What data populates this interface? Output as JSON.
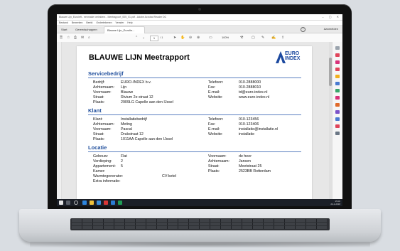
{
  "window": {
    "title": "Blauwe Lijn_Euroleft - eenmalie verleiders - Meetrapport_005_01.pdf - Adobe Acrobat Reader DC",
    "menu": [
      "Bestand",
      "Bewerken",
      "Beeld",
      "Ondertekenen",
      "Venster",
      "Help"
    ],
    "tabs": [
      "Start",
      "Gereedschappen",
      "Blauwe Lijn_Eurolin..."
    ],
    "tab_right": "Aanmelden",
    "help": "?",
    "page_current": "1",
    "page_total": "/ 1",
    "zoom": "100%"
  },
  "document": {
    "title": "BLAUWE LIJN  Meetrapport",
    "logo": {
      "line1": "EURO",
      "line2": "INDEX"
    },
    "sections": {
      "servicebedrijf": {
        "heading": "Servicebedrijf",
        "left": [
          {
            "label": "Bedrijf:",
            "value": "EURO-INDEX b.v."
          },
          {
            "label": "Achternaam:",
            "value": "Lijn"
          },
          {
            "label": "Voornaam:",
            "value": "Blauwe"
          },
          {
            "label": "Straat:",
            "value": "Rivium 2e straat  12"
          },
          {
            "label": "Plaats:",
            "value": "2909LG Capelle aan den IJssel"
          }
        ],
        "right": [
          {
            "label": "Telefoon:",
            "value": "010-2888000"
          },
          {
            "label": "Fax:",
            "value": "010-2888010"
          },
          {
            "label": "E-mail:",
            "value": "td@euro-index.nl"
          },
          {
            "label": "Website:",
            "value": "www.euro-index.nl"
          }
        ]
      },
      "klant": {
        "heading": "Klant",
        "left": [
          {
            "label": "Klant:",
            "value": "Installatiebedrijf"
          },
          {
            "label": "Achternaam:",
            "value": "Meting"
          },
          {
            "label": "Voornaam:",
            "value": "Pascal"
          },
          {
            "label": "Straat:",
            "value": "Drukstraat 12"
          },
          {
            "label": "Plaats:",
            "value": "1011AA Capelle aan den IJssel"
          }
        ],
        "right": [
          {
            "label": "Telefoon:",
            "value": "010-123456"
          },
          {
            "label": "Fax:",
            "value": "010-123406"
          },
          {
            "label": "E-mail:",
            "value": "installatie@installatie.nl"
          },
          {
            "label": "Website:",
            "value": "installatie"
          }
        ]
      },
      "locatie": {
        "heading": "Locatie",
        "left": [
          {
            "label": "Gebouw:",
            "value": "Flat"
          },
          {
            "label": "Verdieping:",
            "value": "2"
          },
          {
            "label": "Appartement:",
            "value": "5"
          },
          {
            "label": "Kamer:",
            "value": ""
          },
          {
            "label": "Warmtegenerator:",
            "value": "CV-ketel"
          },
          {
            "label": "Extra informatie:",
            "value": ""
          }
        ],
        "right": [
          {
            "label": "Voornaam:",
            "value": "de heer"
          },
          {
            "label": "Achternaam:",
            "value": "Jansen"
          },
          {
            "label": "Straat:",
            "value": "Meetstraat 25"
          },
          {
            "label": "Plaats:",
            "value": "2523BB Rotterdam"
          }
        ]
      }
    }
  },
  "taskbar": {
    "time": "15:00",
    "date": "24-1-2018"
  },
  "colors": {
    "section_heading": "#1f4e9c",
    "rule": "#5a7fc0",
    "taskbar": "#1b1f27"
  }
}
